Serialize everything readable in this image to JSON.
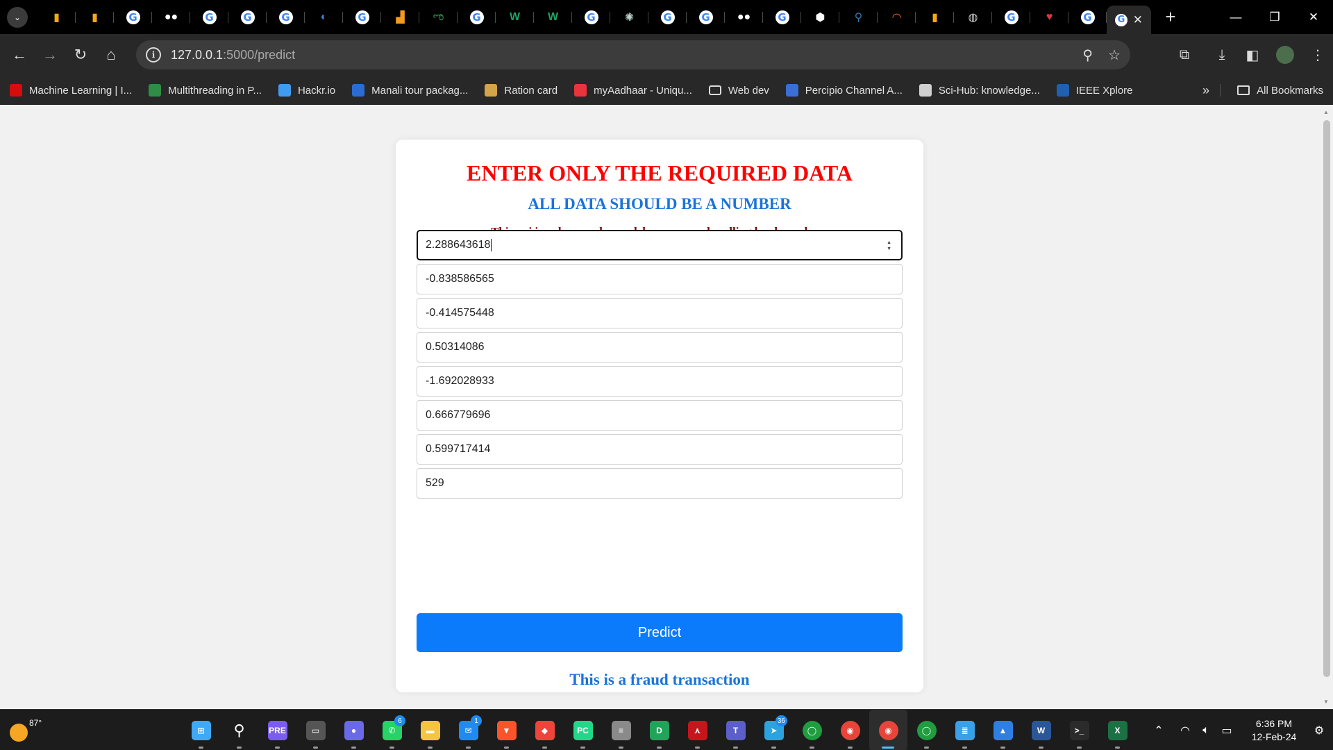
{
  "browser": {
    "tabs": [
      {
        "icon": "book-icon",
        "color": "#f7a71b",
        "glyph": "▮"
      },
      {
        "icon": "book-icon",
        "color": "#f7a71b",
        "glyph": "▮"
      },
      {
        "icon": "google-icon",
        "color": "#ffffff",
        "glyph": "G"
      },
      {
        "icon": "medium-icon",
        "color": "#ffffff",
        "glyph": "●●"
      },
      {
        "icon": "google-icon",
        "color": "#ffffff",
        "glyph": "G"
      },
      {
        "icon": "google-icon",
        "color": "#ffffff",
        "glyph": "G"
      },
      {
        "icon": "google-icon",
        "color": "#ffffff",
        "glyph": "G"
      },
      {
        "icon": "globe-icon",
        "color": "#4a7fd4",
        "glyph": "◐"
      },
      {
        "icon": "google-icon",
        "color": "#ffffff",
        "glyph": "G"
      },
      {
        "icon": "chart-icon",
        "color": "#f29b1f",
        "glyph": "▟"
      },
      {
        "icon": "geeks-icon",
        "color": "#2f8d46",
        "glyph": "ಌ"
      },
      {
        "icon": "google-icon",
        "color": "#ffffff",
        "glyph": "G"
      },
      {
        "icon": "w-icon",
        "color": "#1fa463",
        "glyph": "W"
      },
      {
        "icon": "w-icon",
        "color": "#1fa463",
        "glyph": "W"
      },
      {
        "icon": "google-icon",
        "color": "#ffffff",
        "glyph": "G"
      },
      {
        "icon": "chatgpt-icon",
        "color": "#b9d3c8",
        "glyph": "✺"
      },
      {
        "icon": "google-icon",
        "color": "#ffffff",
        "glyph": "G"
      },
      {
        "icon": "google-icon",
        "color": "#ffffff",
        "glyph": "G"
      },
      {
        "icon": "medium-icon",
        "color": "#ffffff",
        "glyph": "●●"
      },
      {
        "icon": "google-icon",
        "color": "#ffffff",
        "glyph": "G"
      },
      {
        "icon": "cube-icon",
        "color": "#ffffff",
        "glyph": "⬢"
      },
      {
        "icon": "python-icon",
        "color": "#3776ab",
        "glyph": "⚲"
      },
      {
        "icon": "circle-icon",
        "color": "#f26322",
        "glyph": "◠"
      },
      {
        "icon": "book-icon",
        "color": "#f7a71b",
        "glyph": "▮"
      },
      {
        "icon": "globe-icon",
        "color": "#cfcfcf",
        "glyph": "◍"
      },
      {
        "icon": "google-icon",
        "color": "#ffffff",
        "glyph": "G"
      },
      {
        "icon": "heart-icon",
        "color": "#e8343c",
        "glyph": "♥"
      },
      {
        "icon": "google-icon",
        "color": "#ffffff",
        "glyph": "G"
      }
    ],
    "url_host": "127.0.0.1",
    "url_path": ":5000/predict"
  },
  "bookmarks": [
    {
      "label": "Machine Learning | I...",
      "icon": "tutorialspoint-icon",
      "color": "#d60d0d"
    },
    {
      "label": "Multithreading in P...",
      "icon": "geeks-icon",
      "color": "#2f8d46"
    },
    {
      "label": "Hackr.io",
      "icon": "terminal-icon",
      "color": "#3f9cf0"
    },
    {
      "label": "Manali tour packag...",
      "icon": "tm-icon",
      "color": "#2b6cd4"
    },
    {
      "label": "Ration card",
      "icon": "emblem-icon",
      "color": "#d4a44a"
    },
    {
      "label": "myAadhaar - Uniqu...",
      "icon": "aadhaar-icon",
      "color": "#e8343c"
    },
    {
      "label": "Web dev",
      "icon": "folder-icon",
      "color": "#dcdcdc"
    },
    {
      "label": "Percipio Channel A...",
      "icon": "percipio-icon",
      "color": "#3a6fd8"
    },
    {
      "label": "Sci-Hub: knowledge...",
      "icon": "scihub-icon",
      "color": "#d0d0d0"
    },
    {
      "label": "IEEE Xplore",
      "icon": "ieee-icon",
      "color": "#2060b0"
    }
  ],
  "all_bookmarks_label": "All Bookmarks",
  "form": {
    "heading": "ENTER ONLY THE REQUIRED DATA",
    "subheading": "ALL DATA SHOULD BE A NUMBER",
    "note": "This api is only a newby model so no error handling has been done.",
    "fields": [
      "2.288643618",
      "-0.838586565",
      "-0.414575448",
      "0.50314086",
      "-1.692028933",
      "0.666779696",
      "0.599717414",
      "529"
    ],
    "button_label": "Predict",
    "result": "This is a fraud transaction"
  },
  "colors": {
    "heading": "#ff0000",
    "subheading": "#1b73d8",
    "note": "#8b0000",
    "button": "#0b7bfb"
  },
  "taskbar": {
    "weather_temp": "87°",
    "apps": [
      {
        "icon": "windows-start-icon",
        "color": "#3fa9f5",
        "glyph": "⊞"
      },
      {
        "icon": "search-icon",
        "color": "#1c1c1c",
        "glyph": "⚲"
      },
      {
        "icon": "copilot-icon",
        "color": "#7b5cf0",
        "glyph": "PRE"
      },
      {
        "icon": "task-view-icon",
        "color": "#555555",
        "glyph": "▭"
      },
      {
        "icon": "chat-icon",
        "color": "#6a6ae8",
        "glyph": "●"
      },
      {
        "icon": "whatsapp-icon",
        "color": "#25d366",
        "glyph": "✆",
        "badge": "6"
      },
      {
        "icon": "file-explorer-icon",
        "color": "#f5c542",
        "glyph": "▬"
      },
      {
        "icon": "mail-icon",
        "color": "#1f8bf0",
        "glyph": "✉",
        "badge": "1"
      },
      {
        "icon": "brave-icon",
        "color": "#fb542b",
        "glyph": "▼"
      },
      {
        "icon": "anydesk-icon",
        "color": "#ef443b",
        "glyph": "◆"
      },
      {
        "icon": "pycharm-icon",
        "color": "#21d789",
        "glyph": "PC"
      },
      {
        "icon": "database-icon",
        "color": "#8a8a8a",
        "glyph": "≡"
      },
      {
        "icon": "d-app-icon",
        "color": "#22a35a",
        "glyph": "D"
      },
      {
        "icon": "acrobat-icon",
        "color": "#c4161c",
        "glyph": "⋏"
      },
      {
        "icon": "teams-icon",
        "color": "#5b5fc7",
        "glyph": "T"
      },
      {
        "icon": "telegram-icon",
        "color": "#2aa3e0",
        "glyph": "➤",
        "badge": "36"
      },
      {
        "icon": "circle-app-icon",
        "color": "#1f9d3f",
        "glyph": "◯"
      },
      {
        "icon": "chrome-icon",
        "color": "#e8443a",
        "glyph": "◉"
      },
      {
        "icon": "chrome-icon",
        "color": "#e8443a",
        "glyph": "◉",
        "active": true
      },
      {
        "icon": "circle-app-icon",
        "color": "#1f9d3f",
        "glyph": "◯"
      },
      {
        "icon": "notepad-icon",
        "color": "#3aa0e8",
        "glyph": "≣"
      },
      {
        "icon": "photos-icon",
        "color": "#2f7fe0",
        "glyph": "▲"
      },
      {
        "icon": "word-icon",
        "color": "#2b5797",
        "glyph": "W"
      },
      {
        "icon": "terminal-icon",
        "color": "#2b2b2b",
        "glyph": ">_"
      },
      {
        "icon": "excel-icon",
        "color": "#1d7044",
        "glyph": "X"
      }
    ],
    "time": "6:36 PM",
    "date": "12-Feb-24"
  }
}
